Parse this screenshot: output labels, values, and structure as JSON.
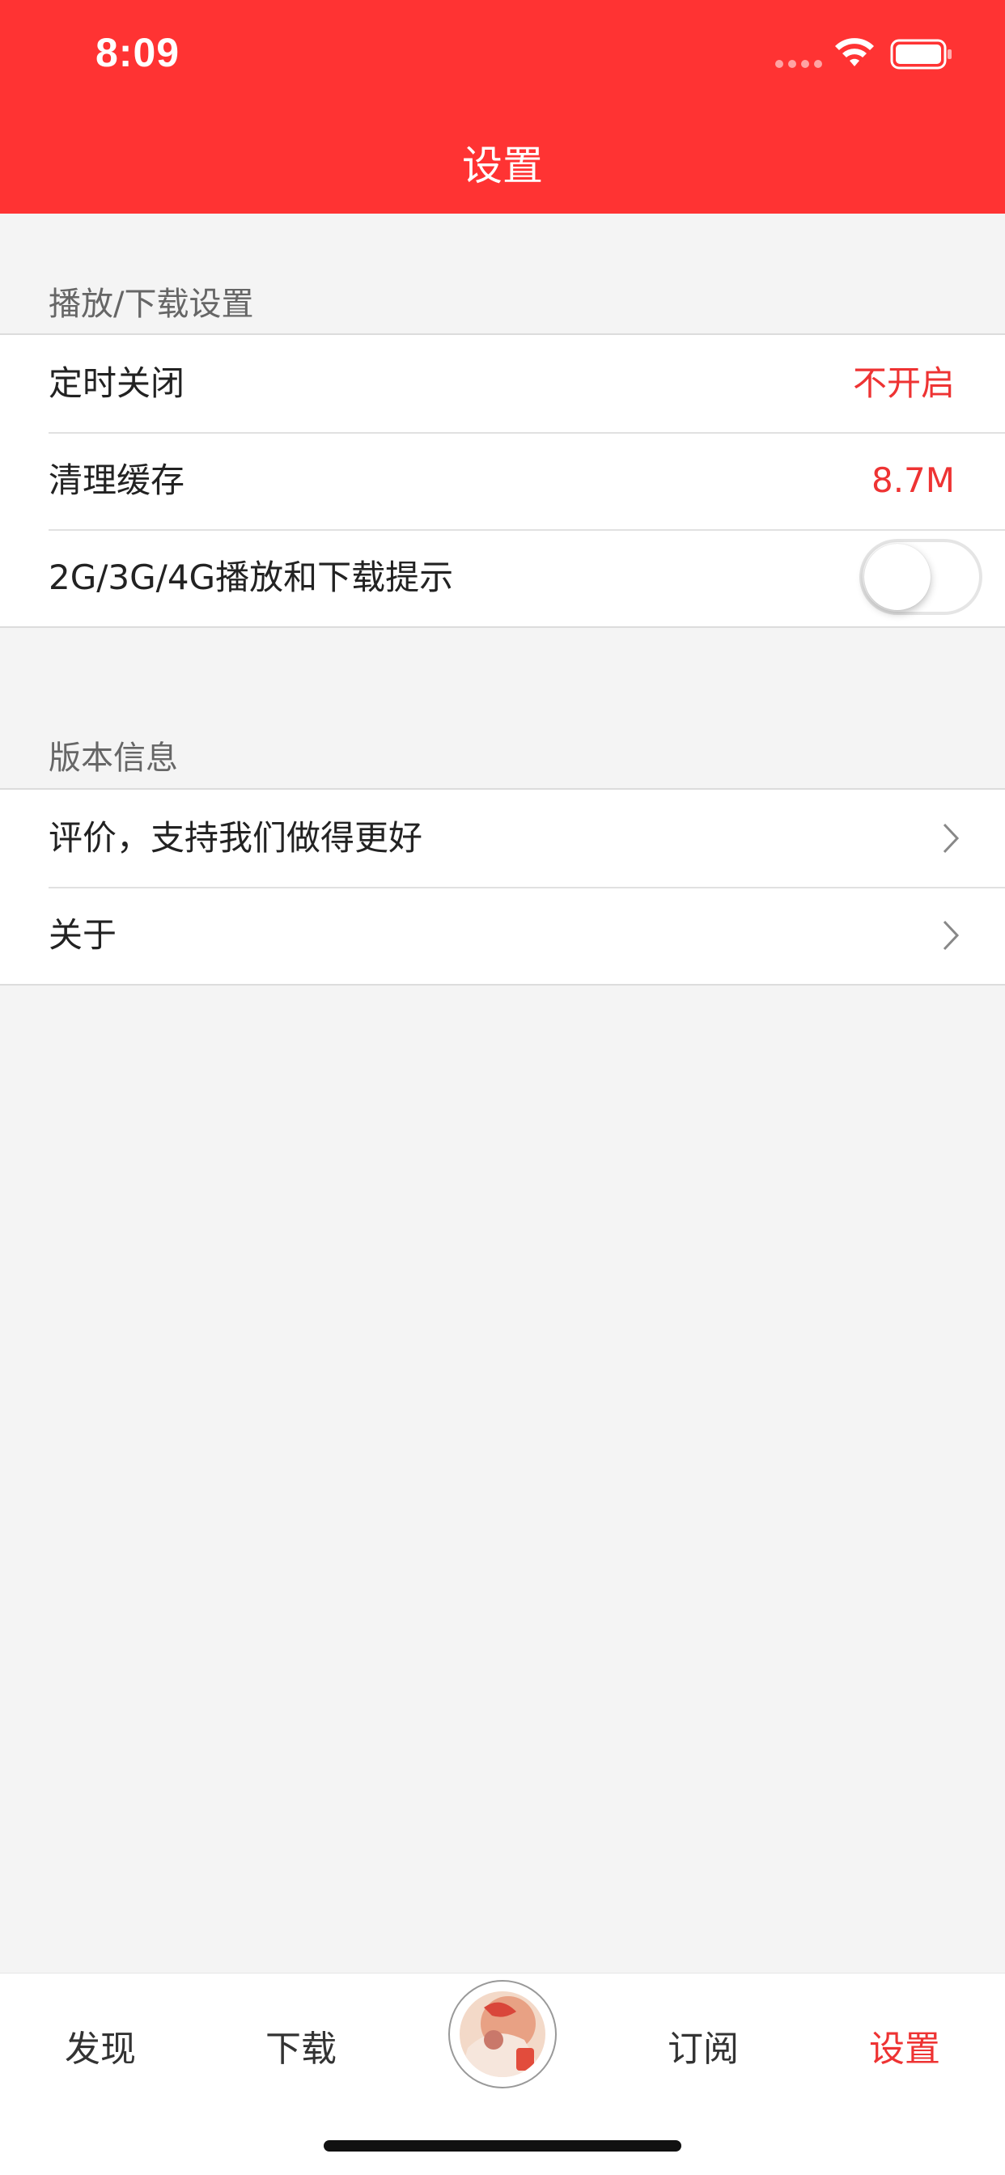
{
  "status_bar": {
    "time": "8:09"
  },
  "nav": {
    "title": "设置"
  },
  "sections": [
    {
      "header": "播放/下载设置",
      "rows": [
        {
          "label": "定时关闭",
          "value": "不开启"
        },
        {
          "label": "清理缓存",
          "value": "8.7M"
        },
        {
          "label": "2G/3G/4G播放和下载提示",
          "toggle_on": false
        }
      ]
    },
    {
      "header": "版本信息",
      "rows": [
        {
          "label": "评价，支持我们做得更好"
        },
        {
          "label": "关于"
        }
      ]
    }
  ],
  "tabbar": {
    "items": [
      {
        "label": "发现"
      },
      {
        "label": "下载"
      },
      {
        "label": "订阅"
      },
      {
        "label": "设置",
        "active": true
      }
    ],
    "center_icon": "album-cover-icon"
  },
  "colors": {
    "accent": "#ff3333",
    "value_red": "#ee3333",
    "background": "#f4f4f4"
  }
}
